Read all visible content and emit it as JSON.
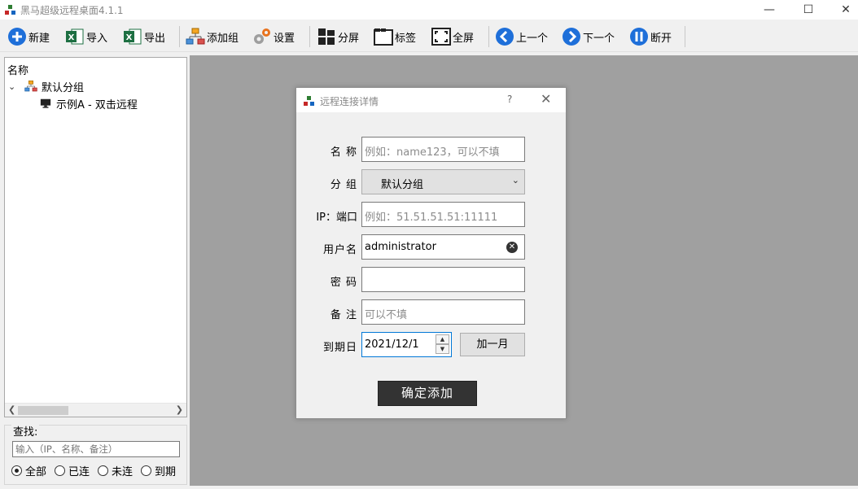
{
  "window": {
    "title": "黑马超级远程桌面4.1.1",
    "min": "—",
    "max": "☐",
    "close": "✕"
  },
  "toolbar": {
    "new": "新建",
    "import": "导入",
    "export": "导出",
    "add_group": "添加组",
    "settings": "设置",
    "split": "分屏",
    "tags": "标签",
    "fullscreen": "全屏",
    "prev": "上一个",
    "next": "下一个",
    "disconnect": "断开"
  },
  "tree": {
    "header": "名称",
    "group": "默认分组",
    "item": "示例A - 双击远程"
  },
  "search": {
    "legend": "查找:",
    "placeholder": "输入（IP、名称、备注）",
    "filters": [
      "全部",
      "已连",
      "未连",
      "到期"
    ],
    "selected": "全部"
  },
  "dialog": {
    "title": "远程连接详情",
    "help": "?",
    "close": "✕",
    "name_label": "名 称",
    "name_placeholder": "例如：name123，可以不填",
    "group_label": "分 组",
    "group_value": "默认分组",
    "ip_label": "IP：端口",
    "ip_placeholder": "例如：51.51.51.51:11111",
    "user_label": "用户名",
    "user_value": "administrator",
    "password_label": "密 码",
    "password_value": "",
    "note_label": "备 注",
    "note_placeholder": "可以不填",
    "expire_label": "到期日",
    "expire_value": "2021/12/1",
    "add_month": "加一月",
    "confirm": "确定添加"
  }
}
